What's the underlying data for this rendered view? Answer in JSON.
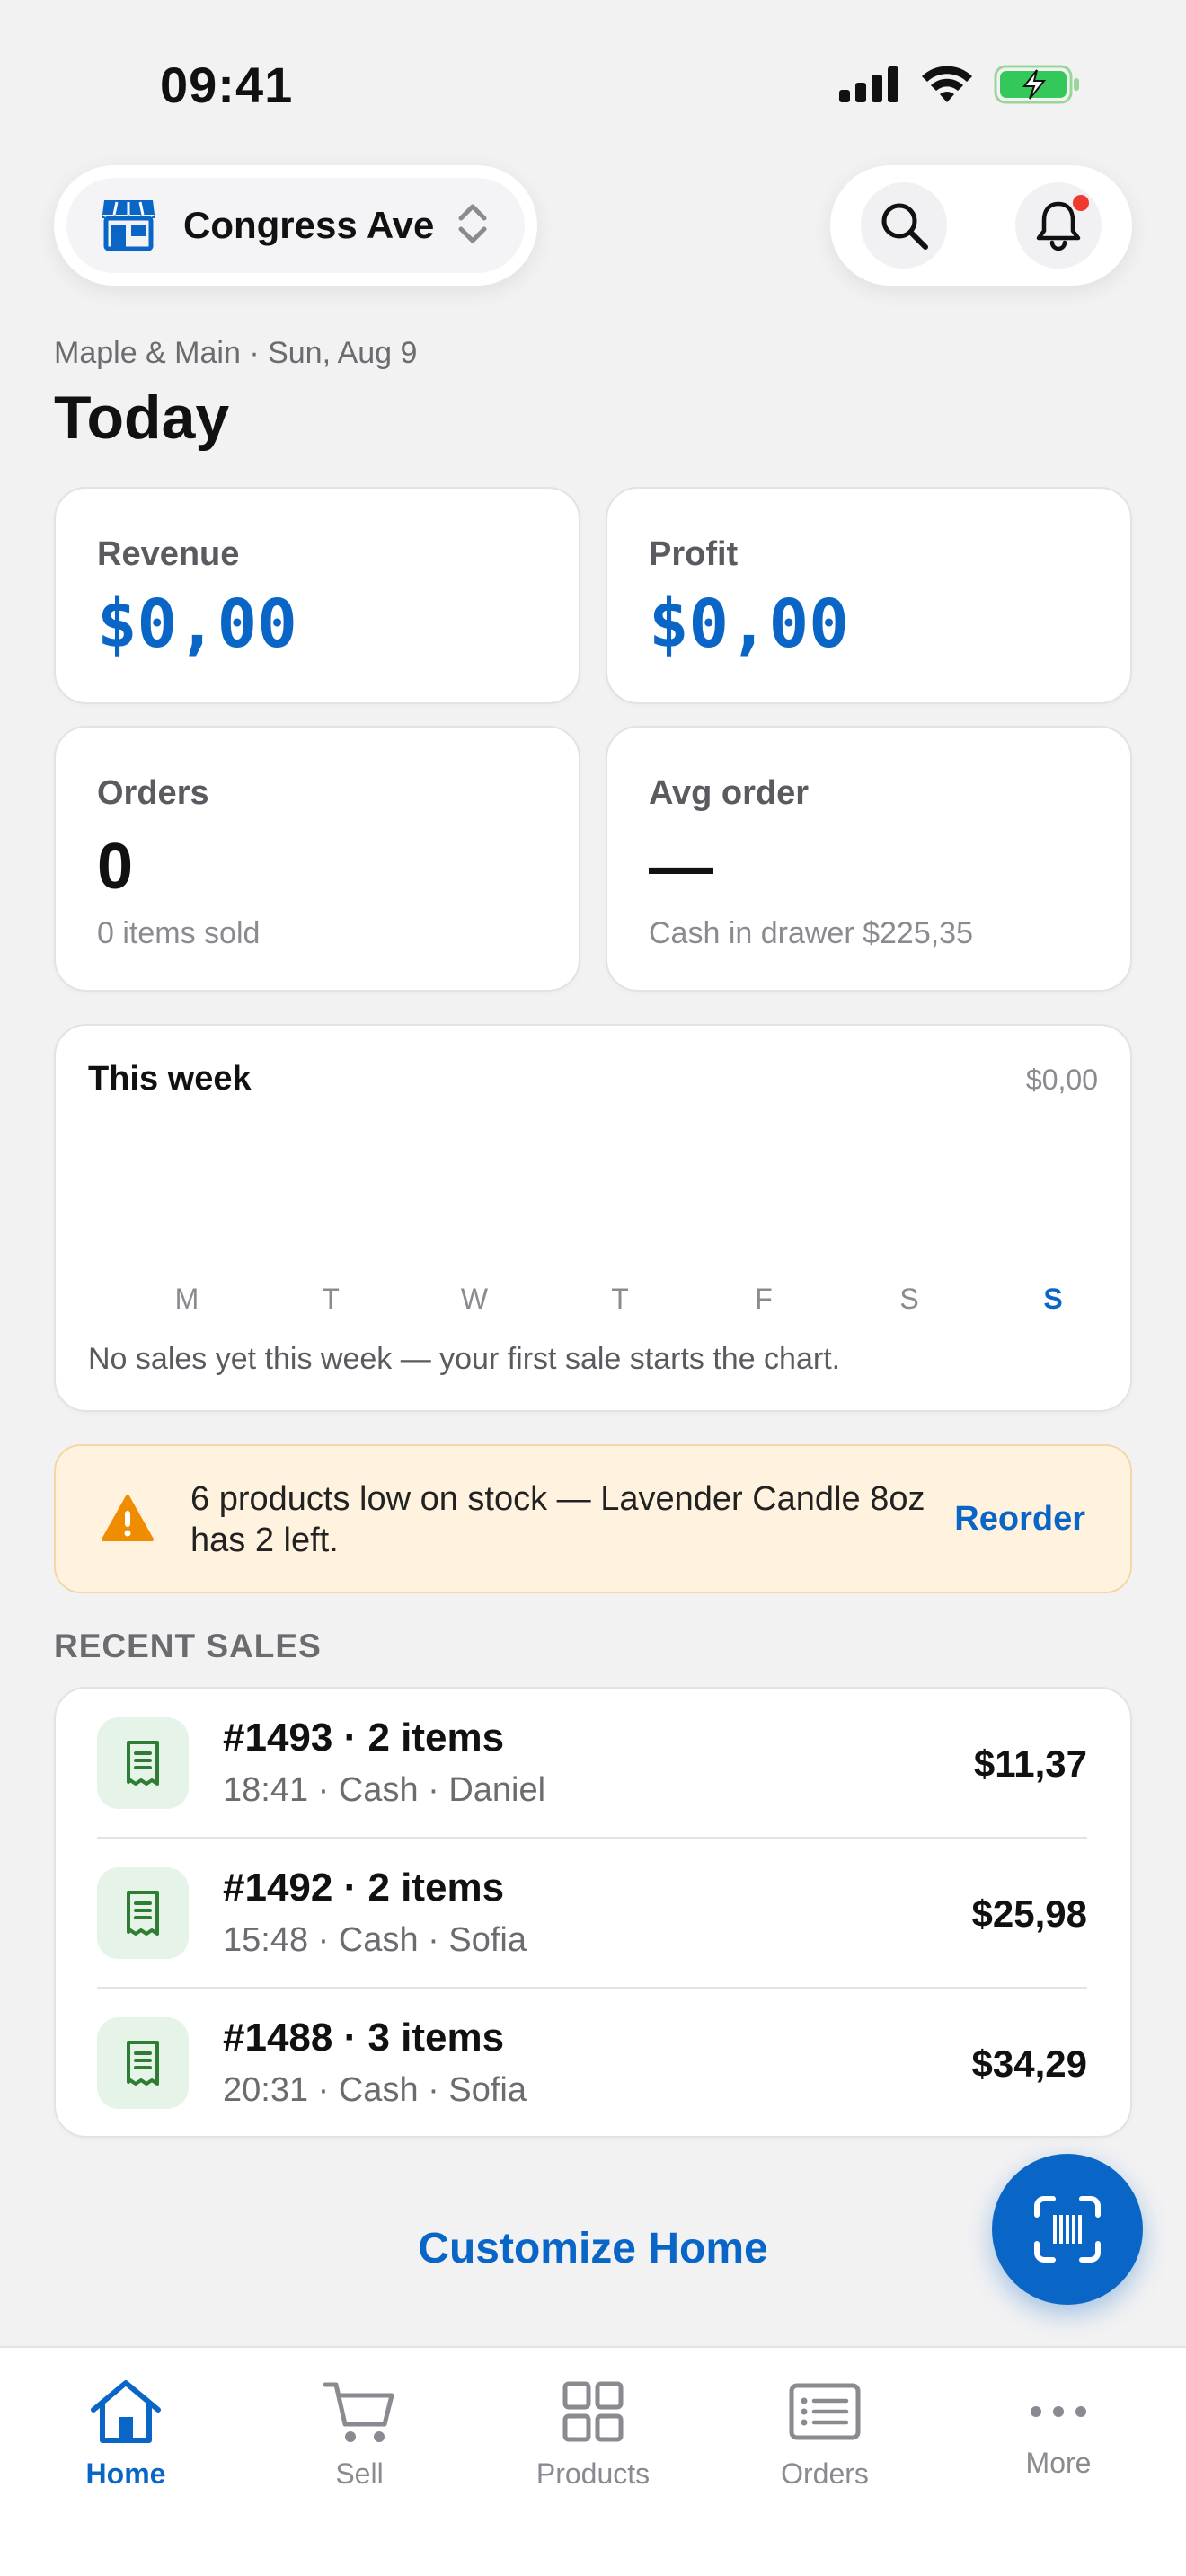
{
  "status_bar": {
    "time": "09:41"
  },
  "header": {
    "store_name": "Congress Ave"
  },
  "subtitle": "Maple & Main · Sun, Aug 9",
  "page_title": "Today",
  "metrics": {
    "revenue": {
      "label": "Revenue",
      "value": "$0,00"
    },
    "profit": {
      "label": "Profit",
      "value": "$0,00"
    },
    "orders": {
      "label": "Orders",
      "value": "0",
      "note": "0 items sold"
    },
    "avg_order": {
      "label": "Avg order",
      "value": "—",
      "note": "Cash in drawer $225,35"
    }
  },
  "week": {
    "title": "This week",
    "total": "$0,00",
    "days": [
      "M",
      "T",
      "W",
      "T",
      "F",
      "S",
      "S"
    ],
    "empty_text": "No sales yet this week — your first sale starts the chart."
  },
  "alert": {
    "text": "6 products low on stock — Lavender Candle 8oz has 2 left.",
    "action": "Reorder"
  },
  "recent_sales": {
    "header": "RECENT SALES",
    "items": [
      {
        "title": "#1493 · 2 items",
        "meta": "18:41 · Cash · Daniel",
        "amount": "$11,37"
      },
      {
        "title": "#1492 · 2 items",
        "meta": "15:48 · Cash · Sofia",
        "amount": "$25,98"
      },
      {
        "title": "#1488 · 3 items",
        "meta": "20:31 · Cash · Sofia",
        "amount": "$34,29"
      }
    ]
  },
  "customize_label": "Customize Home",
  "tabs": [
    {
      "label": "Home",
      "icon": "home-icon"
    },
    {
      "label": "Sell",
      "icon": "cart-icon"
    },
    {
      "label": "Products",
      "icon": "grid-icon"
    },
    {
      "label": "Orders",
      "icon": "list-icon"
    },
    {
      "label": "More",
      "icon": "more-icon"
    }
  ],
  "colors": {
    "accent": "#0a66c6",
    "warning": "#f08c00",
    "alert_bg": "#fff3e0",
    "success_bg": "#e6f3e8",
    "success": "#2e7d32"
  }
}
